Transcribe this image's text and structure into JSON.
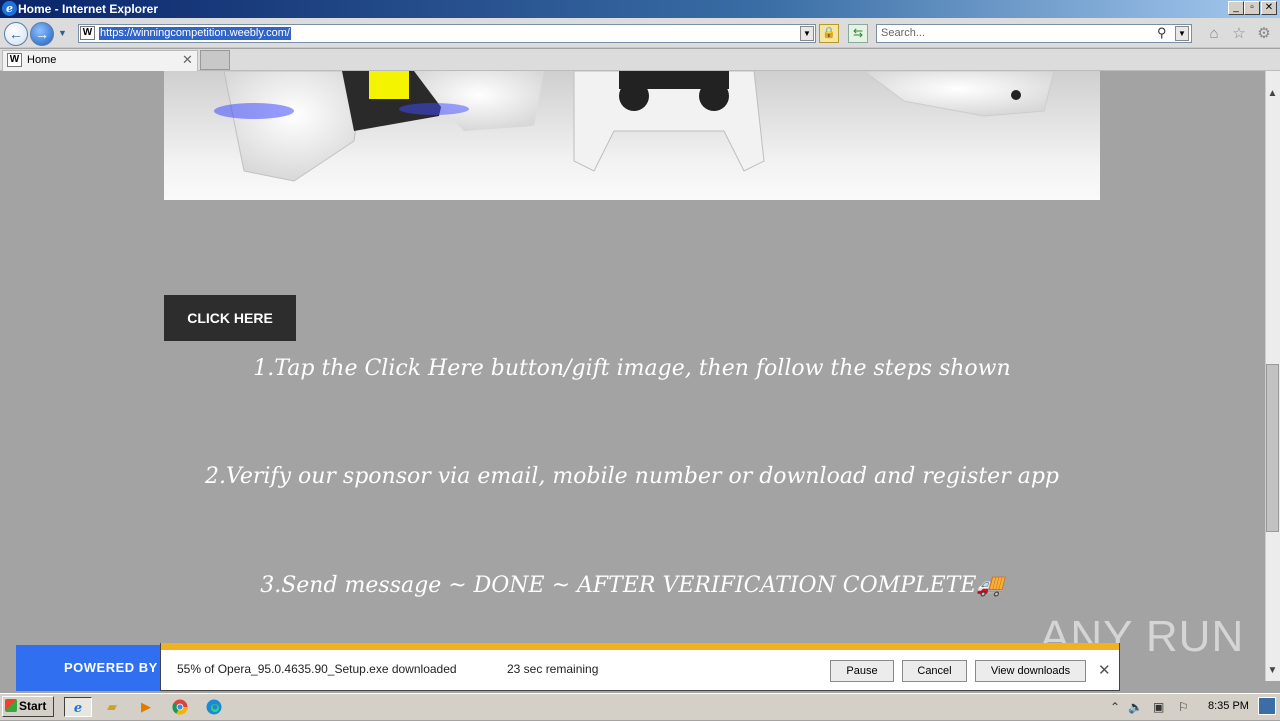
{
  "window": {
    "title": "Home - Internet Explorer",
    "controls": [
      "minimize",
      "restore",
      "close"
    ]
  },
  "toolbar": {
    "url": "https://winningcompetition.weebly.com/",
    "site_icon_letter": "W",
    "search_placeholder": "Search..."
  },
  "tabs": [
    {
      "label": "Home",
      "favicon_letter": "W"
    }
  ],
  "page": {
    "button_label": "CLICK HERE",
    "steps": [
      "1.Tap the Click Here button/gift image, then follow the steps shown",
      "2.Verify our sponsor via email, mobile number or download and register app",
      "3.Send message ~ DONE ~ AFTER VERIFICATION COMPLETE🚚"
    ],
    "powered_by": "POWERED BY"
  },
  "download": {
    "progress_percent": 55,
    "status": "55% of Opera_95.0.4635.90_Setup.exe downloaded",
    "remaining": "23 sec remaining",
    "buttons": {
      "pause": "Pause",
      "cancel": "Cancel",
      "view": "View downloads"
    }
  },
  "watermark": "ANY RUN",
  "taskbar": {
    "start_label": "Start",
    "clock": "8:35 PM"
  },
  "colors": {
    "page_bg": "#a3a3a3",
    "button_bg": "#2d2d2d",
    "progress": "#f0b21e",
    "powered_by_bg": "#2f6ff0"
  }
}
